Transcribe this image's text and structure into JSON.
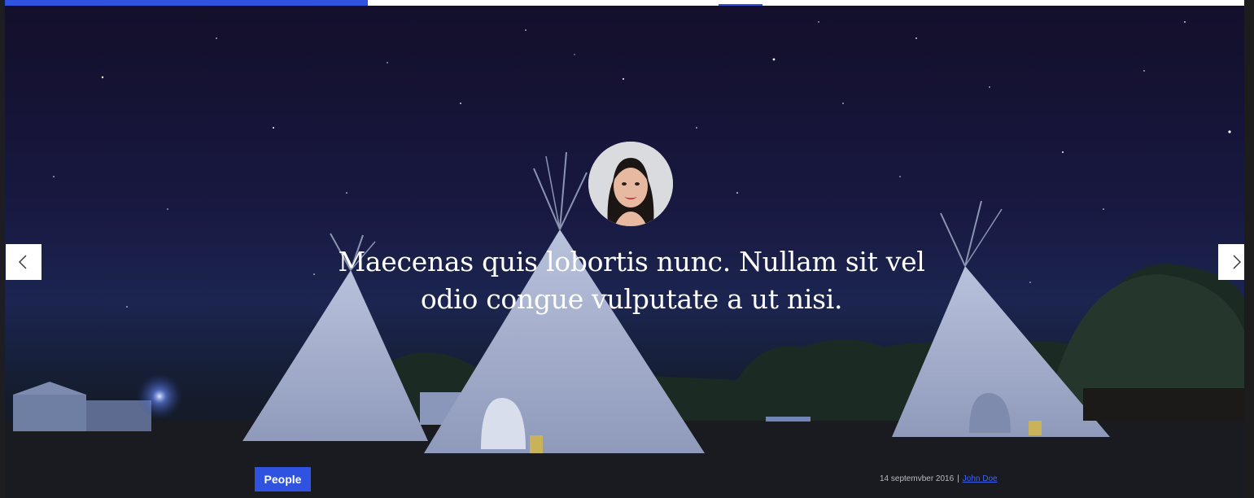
{
  "hero": {
    "quote": "Maecenas quis lobortis nunc. Nullam sit vel odio congue vulputate a ut nisi.",
    "category": "People",
    "date": "14 septemvber 2016",
    "separator": "|",
    "author": "John Doe"
  },
  "nav": {
    "prev_icon": "chevron-left-icon",
    "next_icon": "chevron-right-icon"
  },
  "colors": {
    "accent": "#2f52e0",
    "link": "#3d63f0",
    "text": "#ffffff"
  }
}
